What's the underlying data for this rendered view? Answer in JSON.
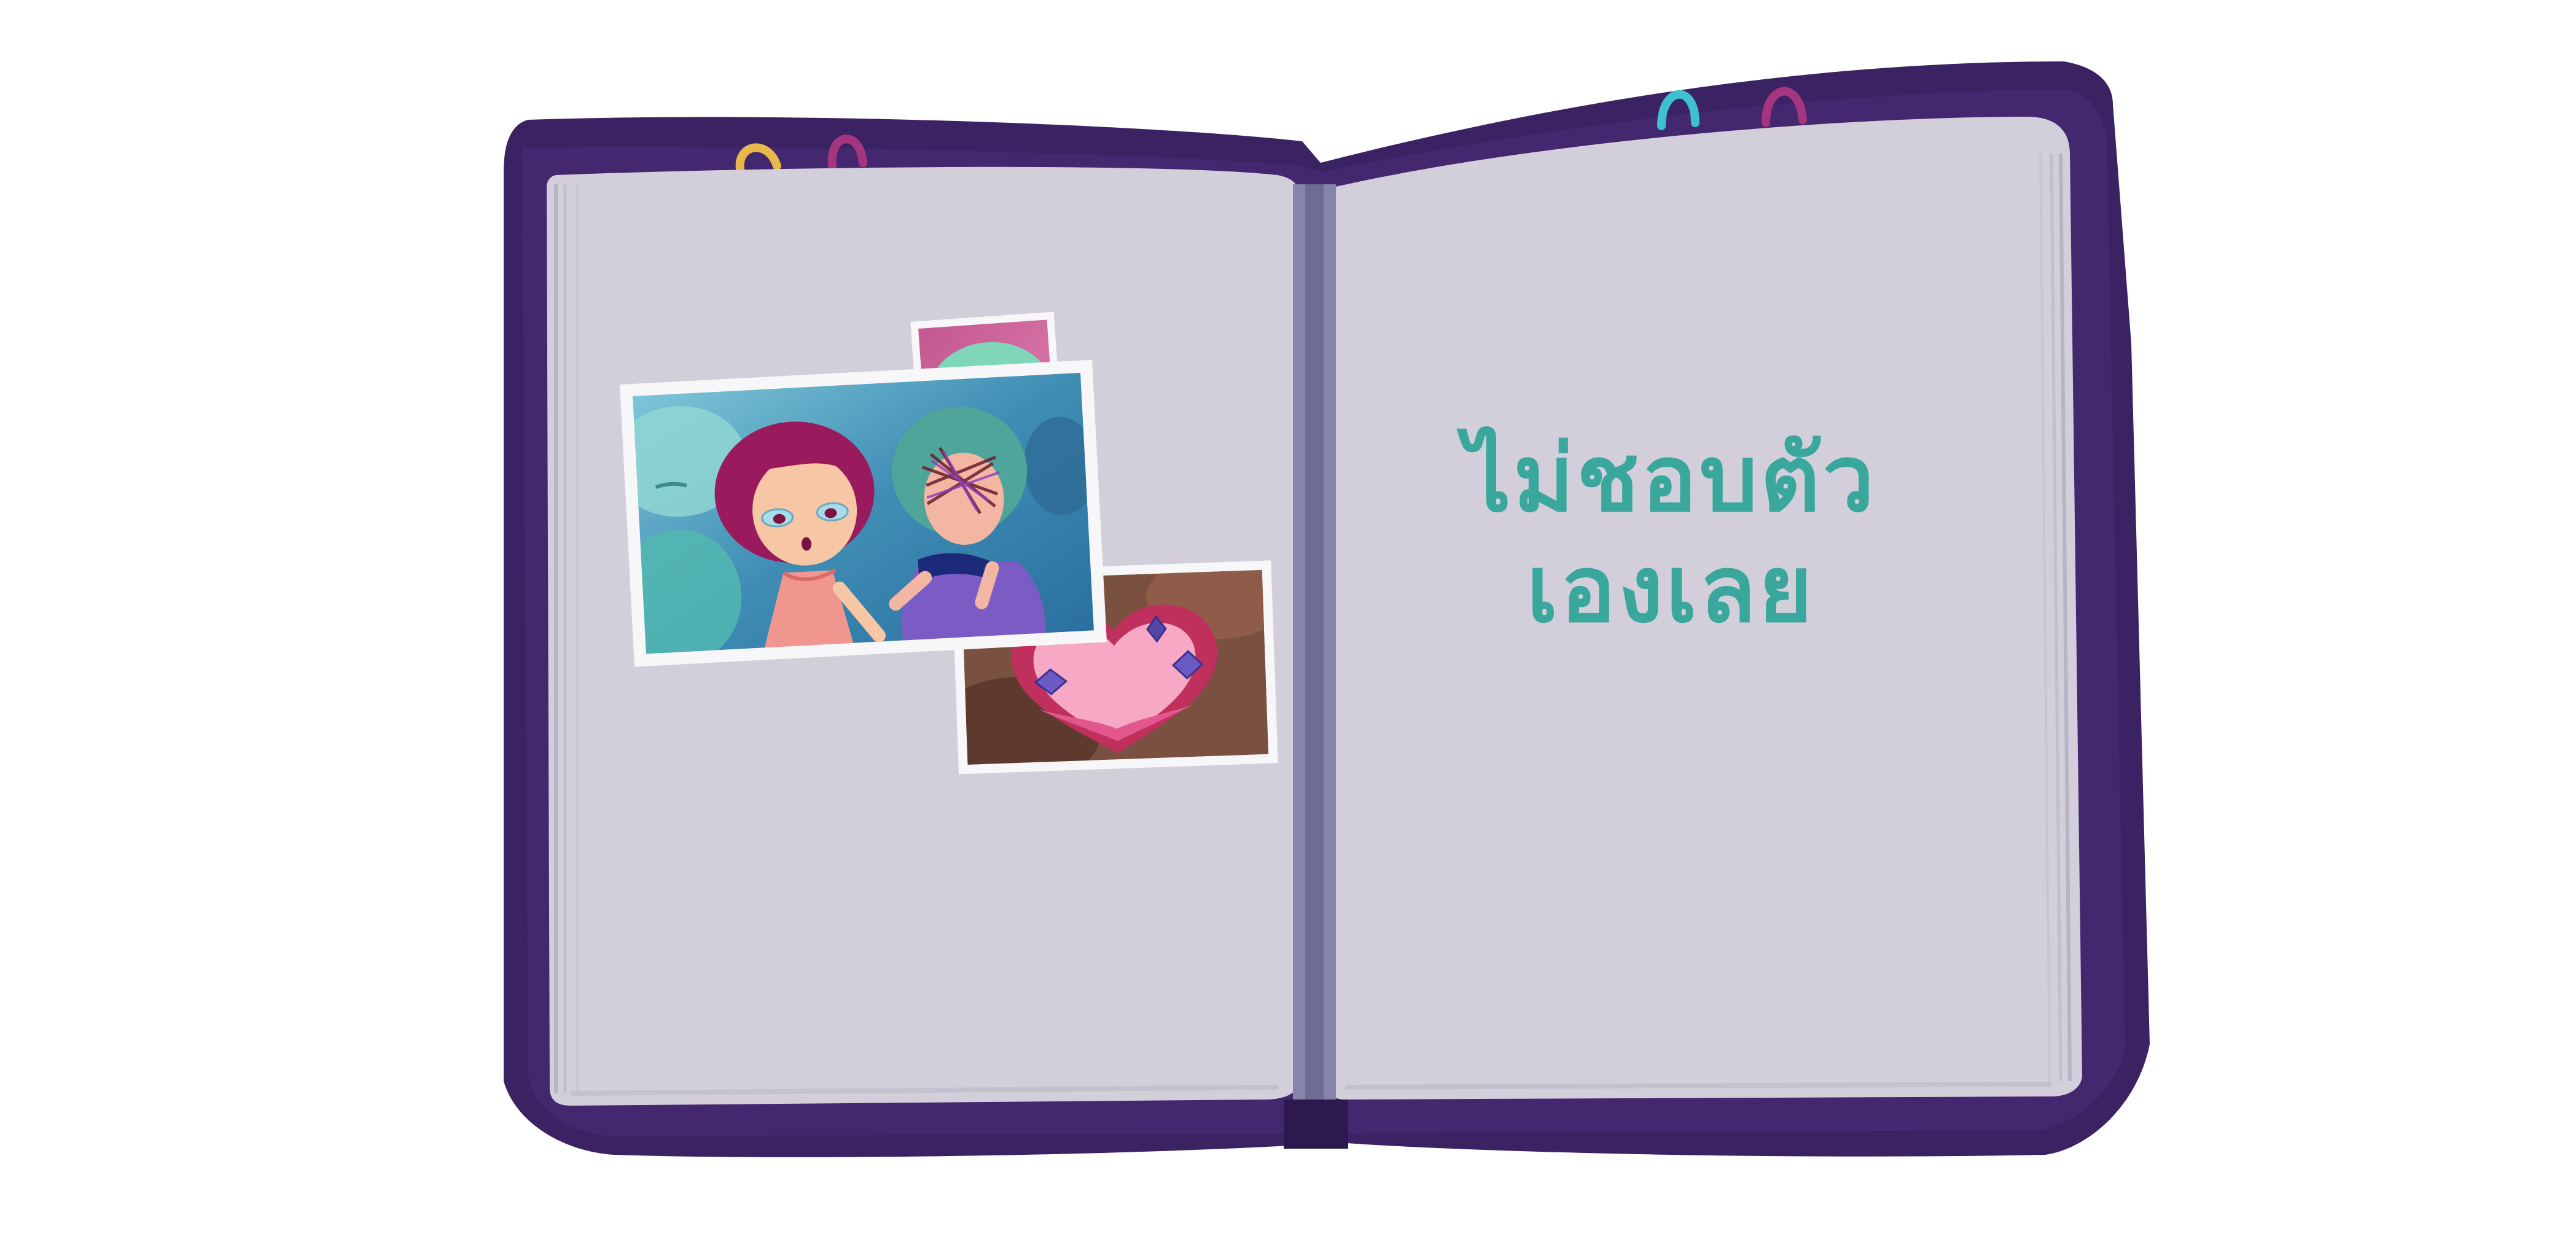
{
  "page_text": {
    "line1": "ไม่ชอบตัว",
    "line2": "เองเลย"
  },
  "colors": {
    "cover": "#3b2363",
    "page": "#d0cdd8",
    "spine": "#7a7aa0",
    "text": "#3aa79c",
    "photo_border": "#f7f7fa"
  },
  "photos": [
    {
      "subject": "two characters: pink-haired girl and teal-haired girl with scribbled face"
    },
    {
      "subject": "mint character with heart eyes"
    },
    {
      "subject": "pink heart with purple gems"
    }
  ]
}
